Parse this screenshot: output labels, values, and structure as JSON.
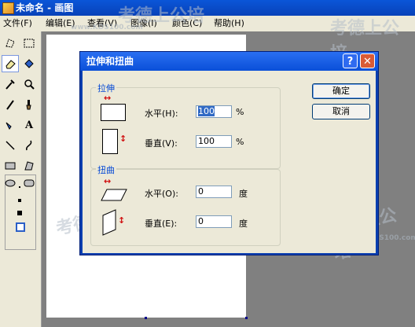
{
  "window": {
    "title": "未命名 - 画图"
  },
  "menu": {
    "items": [
      "文件(F)",
      "编辑(E)",
      "查看(V)",
      "图像(I)",
      "颜色(C)",
      "帮助(H)"
    ]
  },
  "toolbox": {
    "tools": [
      "free-select",
      "rect-select",
      "eraser",
      "fill",
      "eyedropper",
      "magnifier",
      "pencil",
      "brush",
      "airbrush",
      "text",
      "line",
      "curve",
      "rectangle",
      "polygon",
      "ellipse",
      "rounded-rectangle"
    ],
    "active_tool": "eraser",
    "text_tool_glyph": "A"
  },
  "dialog": {
    "title": "拉伸和扭曲",
    "help_label": "?",
    "close_label": "✕",
    "stretch": {
      "label": "拉伸",
      "horizontal_label": "水平(H):",
      "horizontal_value": "100",
      "vertical_label": "垂直(V):",
      "vertical_value": "100",
      "unit": "%"
    },
    "skew": {
      "label": "扭曲",
      "horizontal_label": "水平(O):",
      "horizontal_value": "0",
      "vertical_label": "垂直(E):",
      "vertical_value": "0",
      "unit": "度"
    },
    "ok_label": "确定",
    "cancel_label": "取消"
  },
  "watermark": {
    "text": "考德上公培",
    "url": "www.KDS100.com"
  }
}
